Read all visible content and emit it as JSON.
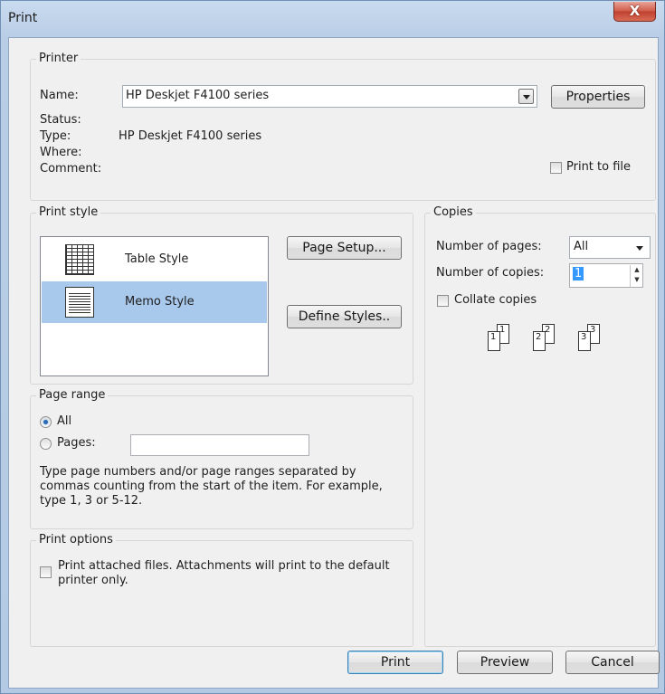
{
  "window": {
    "title": "Print",
    "close_glyph": "X"
  },
  "printer": {
    "group_label": "Printer",
    "name_label": "Name:",
    "name_value": "HP Deskjet F4100 series",
    "properties_button": "Properties",
    "status_label": "Status:",
    "status_value": "",
    "type_label": "Type:",
    "type_value": "HP Deskjet F4100 series",
    "where_label": "Where:",
    "where_value": "",
    "comment_label": "Comment:",
    "comment_value": "",
    "print_to_file_label": "Print to file",
    "print_to_file_checked": false
  },
  "print_style": {
    "group_label": "Print style",
    "styles": [
      {
        "label": "Table Style",
        "icon": "table-style-icon",
        "selected": false
      },
      {
        "label": "Memo Style",
        "icon": "memo-style-icon",
        "selected": true
      }
    ],
    "page_setup_button": "Page Setup...",
    "define_styles_button": "Define Styles.."
  },
  "copies": {
    "group_label": "Copies",
    "number_of_pages_label": "Number of pages:",
    "number_of_pages_value": "All",
    "number_of_copies_label": "Number of copies:",
    "number_of_copies_value": "1",
    "collate_label": "Collate copies",
    "collate_checked": false,
    "collate_illustration": [
      "1",
      "1",
      "2",
      "2",
      "3",
      "3"
    ]
  },
  "page_range": {
    "group_label": "Page range",
    "all_label": "All",
    "all_selected": true,
    "pages_label": "Pages:",
    "pages_value": "",
    "help_text": "Type page numbers and/or page ranges separated by commas counting from the start of the item.  For example, type 1, 3 or 5-12."
  },
  "print_options": {
    "group_label": "Print options",
    "attached_files_label": "Print attached files.  Attachments will print to the default printer only.",
    "attached_files_checked": false
  },
  "footer": {
    "print_button": "Print",
    "preview_button": "Preview",
    "cancel_button": "Cancel"
  },
  "colors": {
    "selection": "#a9c9ec",
    "close_button": "#c0402f",
    "default_button_border": "#3c7fb1"
  }
}
